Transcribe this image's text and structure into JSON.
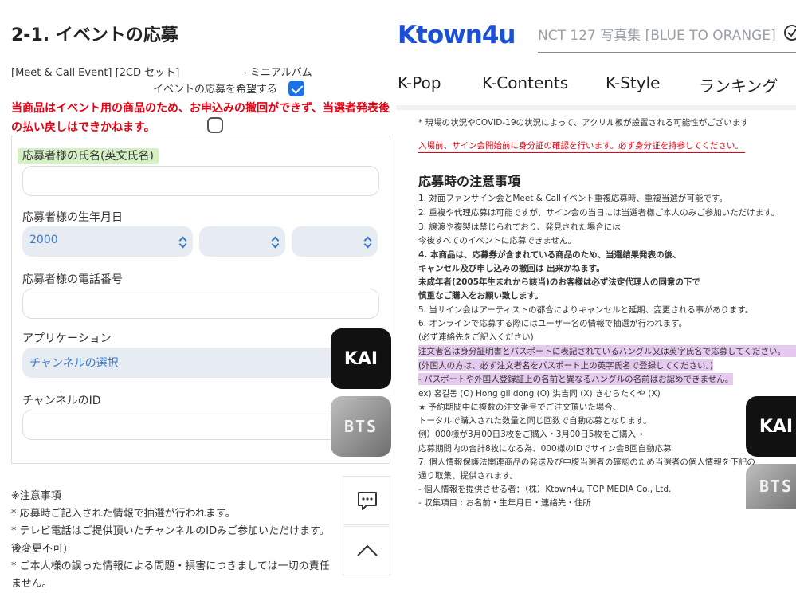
{
  "left": {
    "section_title": "2-1. イベントの応募",
    "product_line": "[Meet & Call Event] [2CD セット]",
    "product_sub": "- ミニアルバム",
    "wish_label": "イベントの応募を希望する",
    "wish_checked": true,
    "warning": "当商品はイベント用の商品のため、お申込みの撤回ができず、当選者発表後の払い戻しはできかねます。",
    "warning_checked": false,
    "form": {
      "name_label": "応募者様の氏名(英文氏名)",
      "name_value": "",
      "birth_label": "応募者様の生年月日",
      "birth_year": "2000",
      "birth_month": "",
      "birth_day": "",
      "phone_label": "応募者様の電話番号",
      "phone_value": "",
      "app_label": "アプリケーション",
      "app_select": "チャンネルの選択",
      "channel_id_label": "チャンネルのID",
      "channel_id_value": ""
    },
    "notes": [
      "※注意事項",
      "* 応募時ご記入された情報で抽選が行われます。",
      "* テレビ電話はご提供頂いたチャンネルのIDみご参加いただけます。",
      "後変更不可)",
      "* ご本人様の誤った情報による問題・損害につきましては一切の責任",
      "ません。"
    ],
    "floating": {
      "kai_label": "KAI",
      "bts_label": "BTS"
    }
  },
  "right": {
    "logo": "Ktown4u",
    "search_text": "NCT 127 写真集 [BLUE TO ORANGE]",
    "nav": [
      "K-Pop",
      "K-Contents",
      "K-Style",
      "ランキング"
    ],
    "intro_line": "* 現場の状況やCOVID-19の状況によって、アクリル板が設置される可能性がございます",
    "red_line": "入場前、サイン会開始前に身分証の確認を行います。必ず身分証を持参してください。",
    "notice_title": "応募時の注意事項",
    "lines": [
      "1. 対面ファンサイン会とMeet & Callイベント重複応募時、重複当選が可能です。",
      "2. 重複や代理応募は可能ですが、サイン会の当日には当選者様ご本人のみご参加いただけます。",
      "3. 譲渡や複製は禁じられており、発見された場合には",
      "    今後すべてのイベントに応募できません。",
      "4. 本商品は、応募券が含まれている商品のため、当選結果発表の後、",
      "    キャンセル及び申し込みの撤回は 出来かねます。",
      "    未成年者(2005年生まれから該当)のお客様は必ず法定代理人の同意の下で",
      "    慎重なご購入をお願い致します。",
      "5. 当サイン会はアーティストの都合によりキャンセルと延期、変更される事があります。",
      "6. オンラインで応募する際にはユーザー名の情報で抽選が行われます。",
      "    (必ず連絡先をご記入ください)",
      "    注文者名は身分証明書とパスポートに表記されているハングル又は英字氏名で応募してください。",
      "    (外国人の方は、必ず注文者名をパスポート上の英字氏名で登録してください。)",
      "    - パスポートや外国人登録証上の名前と異なるハングルの名前はお認めできません。",
      "    ex) 홍길동 (O)     Hong gil dong (O)     洪吉同 (X)     きむらたくや (X)",
      "    ★ 予約期間中に複数の注文番号でご注文頂いた場合、",
      "    トータルで購入された数量と同じ回数で自動応募となります。",
      "    例）000様が3月00日3枚をご購入・3月00日5枚をご購入→",
      "    応募期間内の合計8枚になる為、000様のIDでサイン会8回自動応募",
      "7. 個人情報保護法関連商品の発送及び中腹当選者の確認のため当選者の個人情報を下記の",
      "    通り取集、提供されます。",
      "    - 個人情報を提供させる者：（株）Ktown4u, TOP MEDIA Co., Ltd.",
      "    - 収集項目 : お名前・生年月日・連絡先・住所"
    ],
    "floating": {
      "kai_label": "KAI",
      "bts_label": "BTS"
    }
  },
  "colors": {
    "brand_blue": "#1a4fd6",
    "warning_red": "#e60012",
    "check_blue": "#1a73e8",
    "highlight_purple": "#e6c9ef",
    "highlight_green": "#d6f0c6"
  }
}
